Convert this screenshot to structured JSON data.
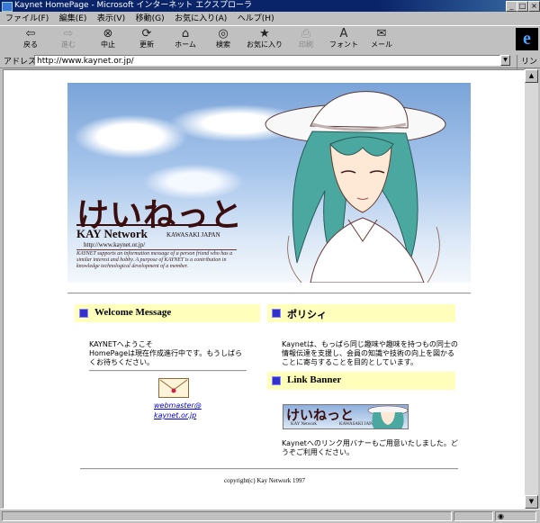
{
  "window": {
    "title": "Kaynet HomePage - Microsoft インターネット エクスプローラ"
  },
  "menu": [
    "ファイル(F)",
    "編集(E)",
    "表示(V)",
    "移動(G)",
    "お気に入り(A)",
    "ヘルプ(H)"
  ],
  "toolbar": [
    {
      "label": "戻る",
      "icon": "back-arrow-icon"
    },
    {
      "label": "進む",
      "icon": "forward-arrow-icon"
    },
    {
      "label": "中止",
      "icon": "stop-icon"
    },
    {
      "label": "更新",
      "icon": "refresh-icon"
    },
    {
      "label": "ホーム",
      "icon": "home-icon"
    },
    {
      "label": "検索",
      "icon": "search-icon"
    },
    {
      "label": "お気に入り",
      "icon": "favorites-icon"
    },
    {
      "label": "印刷",
      "icon": "print-icon"
    },
    {
      "label": "フォント",
      "icon": "font-icon"
    },
    {
      "label": "メール",
      "icon": "mail-icon"
    }
  ],
  "address": {
    "label": "アドレス",
    "url": "http://www.kaynet.or.jp/",
    "go_label": "リンク"
  },
  "banner": {
    "title": "けいねっと",
    "subtitle": "KAY Network",
    "location": "KAWASAKI JAPAN",
    "url": "http://www.kaynet.or.jp/",
    "description": "KAYNET supports an information message of a person friend who has a similar interest and hobby. A purpose of KAYNET is a contribution in knowledge technological development of a member."
  },
  "welcome": {
    "heading": "Welcome Message",
    "line1": "KAYNETへようこそ",
    "line2": "HomePageは現在作成進行中です。もうしばらくお待ちください。",
    "mail_line1": "webmaster@",
    "mail_line2": "kaynet.or.jp"
  },
  "policy": {
    "heading": "ポリシィ",
    "text": "Kaynetは、もっぱら同じ趣味や趣味を持つもの同士の情報伝達を支援し、会員の知識や技術の向上を図かることに寄与することを目的としています。"
  },
  "link_banner": {
    "heading": "Link Banner",
    "banner_title": "けいねっと",
    "banner_sub": "KAY Network",
    "banner_loc": "KAWASAKI JAPAN",
    "text": "Kaynetへのリンク用バナーもご用意いたしました。どうぞご利用ください。"
  },
  "footer": {
    "copyright": "copyright(c) Kay Network 1997"
  },
  "colors": {
    "header_bg": "#ffffbb",
    "bullet": "#3333cc",
    "link": "#0000cc",
    "titlebar": "#0a246a"
  }
}
